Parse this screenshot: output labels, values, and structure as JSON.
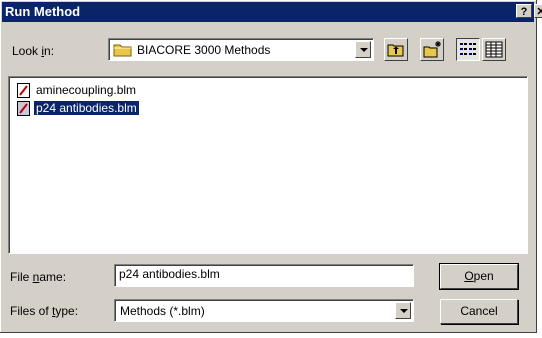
{
  "window": {
    "title": "Run Method",
    "help_label": "?",
    "close_label": "✕"
  },
  "look_in": {
    "label_prefix": "Look ",
    "label_key": "i",
    "label_suffix": "n:",
    "value": "BIACORE 3000 Methods"
  },
  "toolbar": {
    "icons": [
      "up-one-level-icon",
      "create-new-folder-icon",
      "list-view-icon",
      "details-view-icon"
    ]
  },
  "files": [
    {
      "name": "aminecoupling.blm",
      "selected": false
    },
    {
      "name": "p24 antibodies.blm",
      "selected": true
    }
  ],
  "file_name": {
    "label_prefix": "File ",
    "label_key": "n",
    "label_suffix": "ame:",
    "value": "p24 antibodies.blm"
  },
  "file_type": {
    "label_prefix": "Files of ",
    "label_key": "t",
    "label_suffix": "ype:",
    "value": "Methods (*.blm)"
  },
  "buttons": {
    "open_key": "O",
    "open_rest": "pen",
    "cancel": "Cancel"
  },
  "colors": {
    "titlebar": "#0a246a",
    "dialog_face": "#d4d0c8",
    "selection": "#0a246a"
  }
}
